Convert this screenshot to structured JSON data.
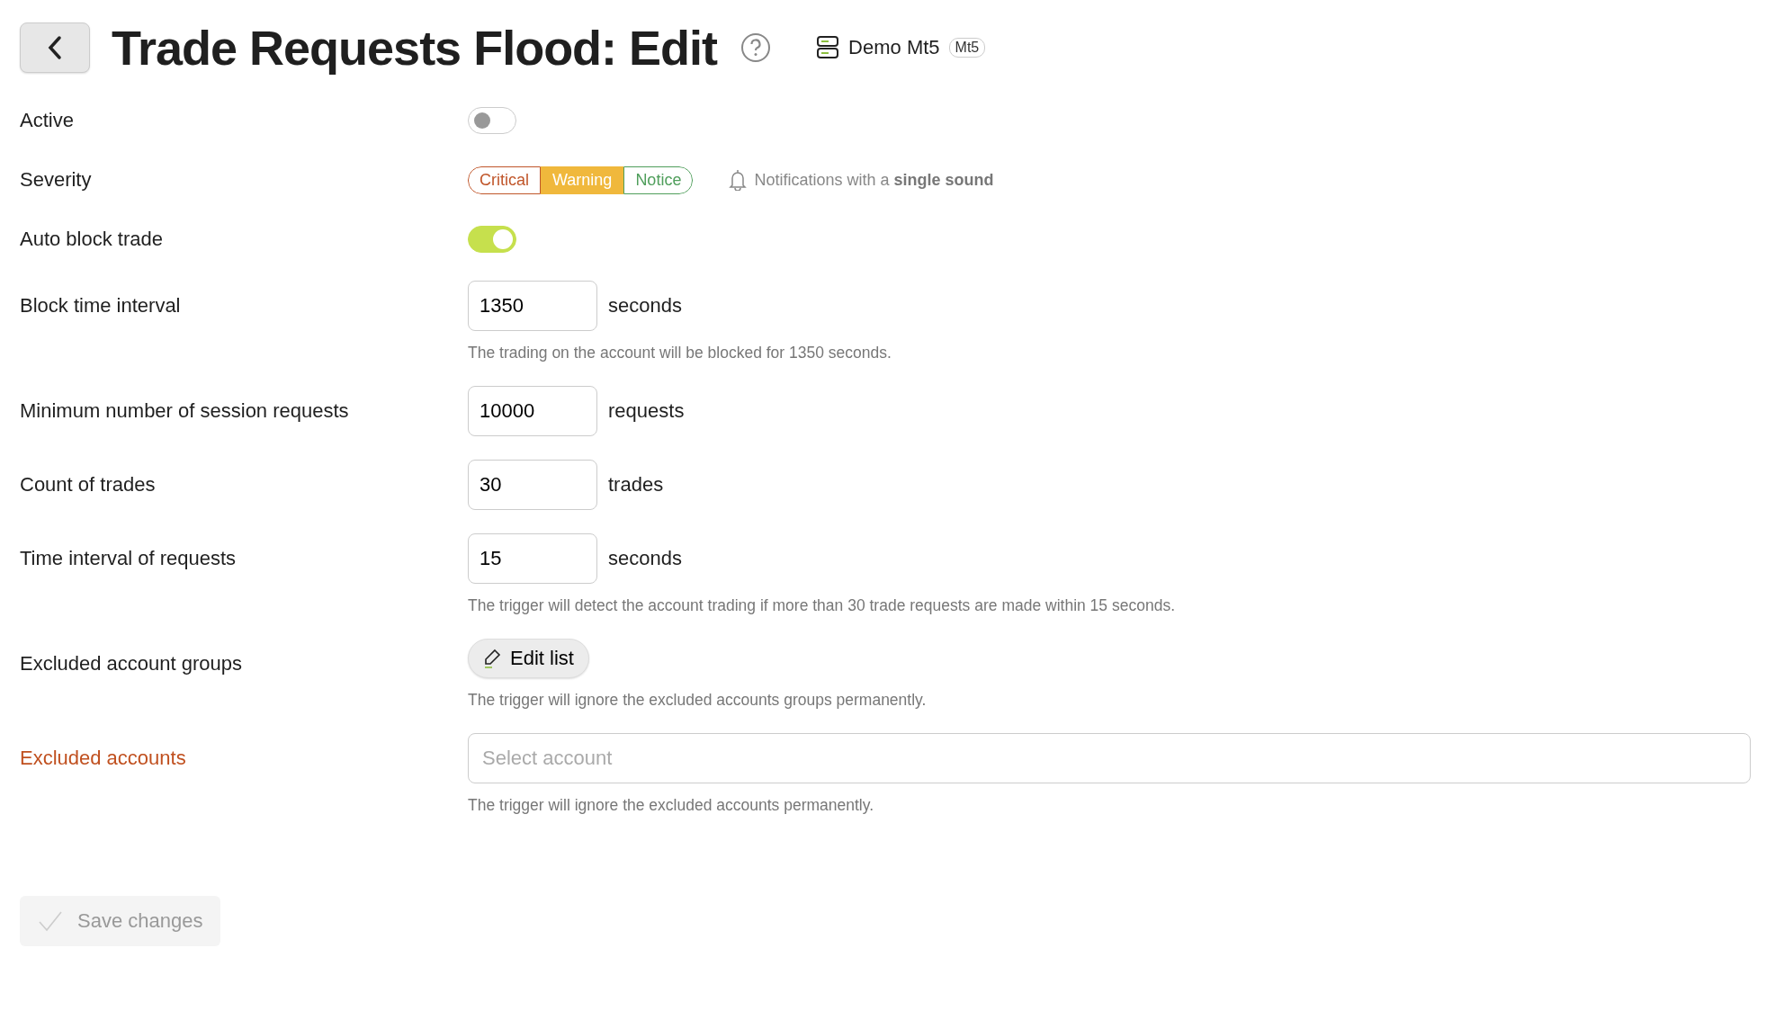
{
  "header": {
    "title": "Trade Requests Flood: Edit",
    "server": "Demo Mt5",
    "server_badge": "Mt5"
  },
  "fields": [
    {
      "kind": "toggle",
      "label": "Active",
      "on": false
    },
    {
      "kind": "severity",
      "label": "Severity",
      "options": [
        {
          "label": "Critical",
          "color": "#c0562a",
          "selected": false
        },
        {
          "label": "Warning",
          "color": "#f0b83c",
          "selected": true
        },
        {
          "label": "Notice",
          "color": "#4f9e5b",
          "selected": false
        }
      ],
      "note": "Notifications with a **single sound**"
    },
    {
      "kind": "toggle",
      "label": "Auto block trade",
      "on": true
    },
    {
      "kind": "number",
      "label": "Block time interval",
      "value": "1350",
      "unit": "seconds",
      "hint": "The trading on the account will be blocked for 1350 seconds."
    },
    {
      "kind": "number",
      "label": "Minimum number of session requests",
      "value": "10000",
      "unit": "requests"
    },
    {
      "kind": "number",
      "label": "Count of trades",
      "value": "30",
      "unit": "trades"
    },
    {
      "kind": "number",
      "label": "Time interval of requests",
      "value": "15",
      "unit": "seconds",
      "hint": "The trigger will detect the account trading if more than 30 trade requests are made within 15 seconds."
    },
    {
      "kind": "list",
      "label": "Excluded account groups",
      "button": "Edit list",
      "hint": "The trigger will ignore the excluded accounts groups permanently."
    },
    {
      "kind": "select",
      "label": "Excluded accounts",
      "invalid": true,
      "placeholder": "Select account",
      "hint": "The trigger will ignore the excluded accounts permanently."
    }
  ],
  "save": {
    "label": "Save changes",
    "disabled": true
  }
}
